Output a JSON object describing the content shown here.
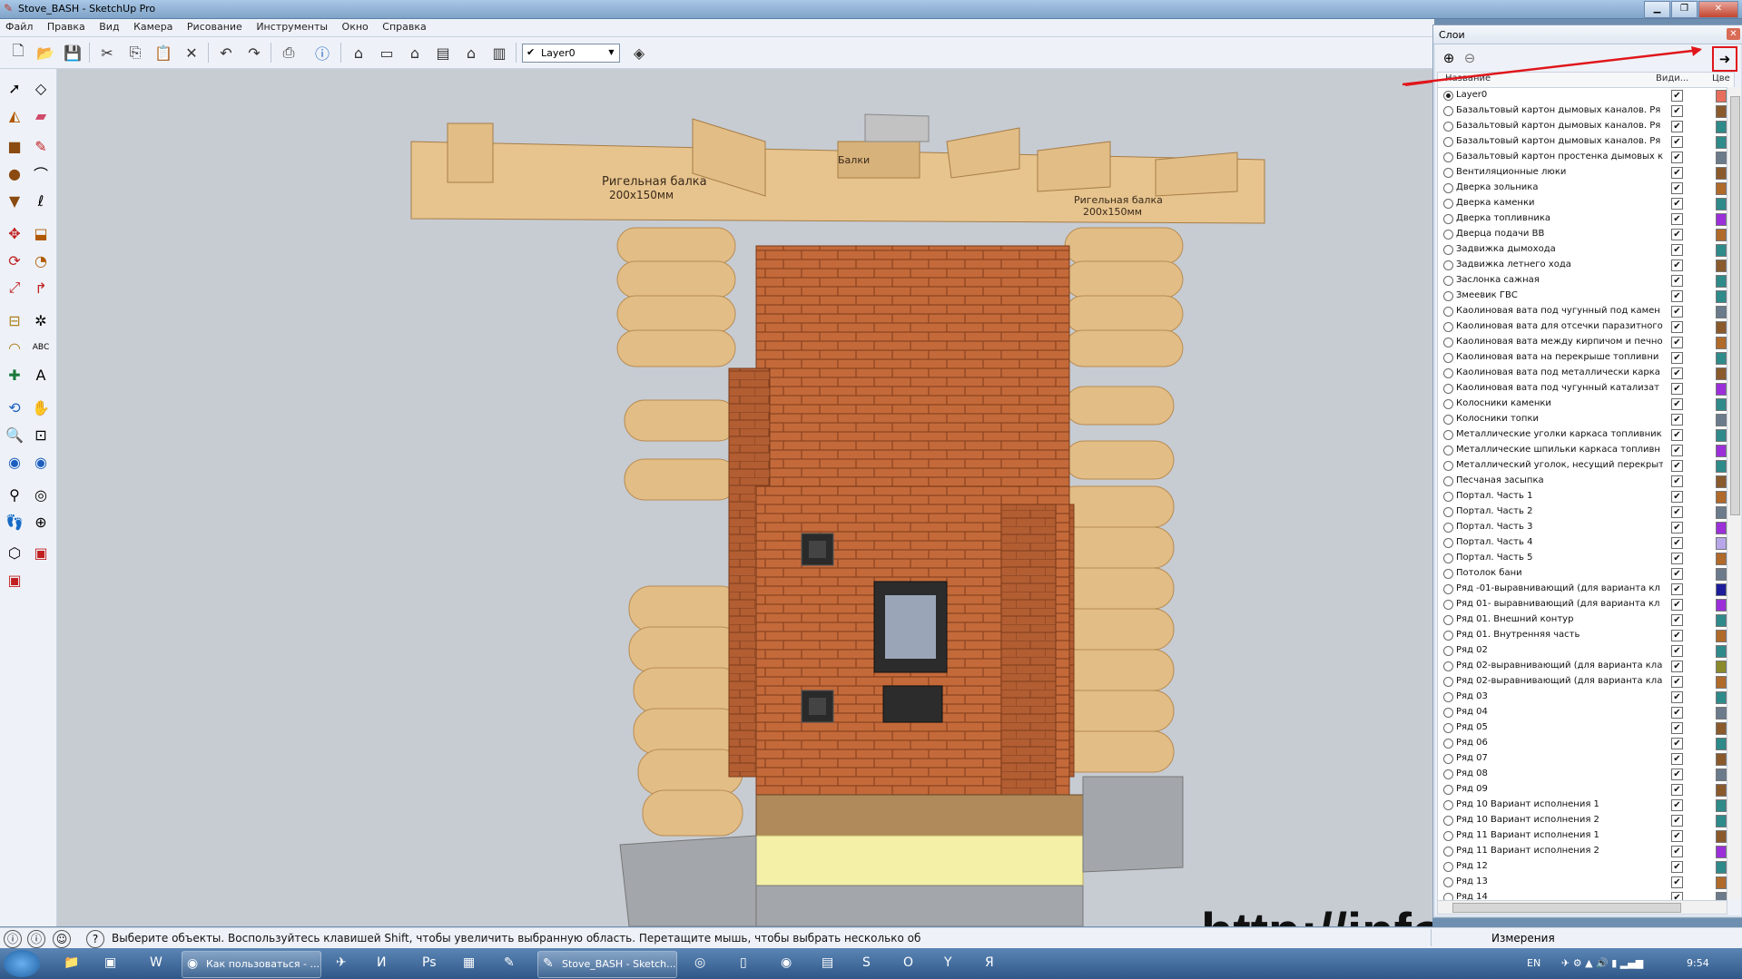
{
  "window": {
    "title": "Stove_BASH - SketchUp Pro",
    "min_icon": "minimize-icon",
    "max_icon": "maximize-icon",
    "close_icon": "close-icon"
  },
  "menu": [
    "Файл",
    "Правка",
    "Вид",
    "Камера",
    "Рисование",
    "Инструменты",
    "Окно",
    "Справка"
  ],
  "toolbar": {
    "layer_value": "Layer0"
  },
  "model": {
    "label_left": "Ригельная балка",
    "label_left_size": "200х150мм",
    "label_middle": "Балки",
    "label_right": "Ригельная балка",
    "label_right_size": "200х150мм"
  },
  "watermark": "http://inforusbani.ru",
  "layers_panel": {
    "title": "Слои",
    "col_name": "Название",
    "col_visible": "Види...",
    "col_color": "Цве",
    "rows": [
      {
        "name": "Layer0",
        "active": true,
        "color": "#e86d5c"
      },
      {
        "name": "Базальтовый картон дымовых каналов. Ря",
        "active": false,
        "color": "#8a5a2c"
      },
      {
        "name": "Базальтовый картон дымовых каналов. Ря",
        "active": false,
        "color": "#2f8a8a"
      },
      {
        "name": "Базальтовый картон дымовых каналов. Ря",
        "active": false,
        "color": "#2f8a8a"
      },
      {
        "name": "Базальтовый картон простенка дымовых к",
        "active": false,
        "color": "#6b7b8c"
      },
      {
        "name": "Вентиляционные люки",
        "active": false,
        "color": "#8a5a2c"
      },
      {
        "name": "Дверка зольника",
        "active": false,
        "color": "#b06a2a"
      },
      {
        "name": "Дверка каменки",
        "active": false,
        "color": "#2f8a8a"
      },
      {
        "name": "Дверка топливника",
        "active": false,
        "color": "#9b30d9"
      },
      {
        "name": "Дверца подачи ВВ",
        "active": false,
        "color": "#b06a2a"
      },
      {
        "name": "Задвижка дымохода",
        "active": false,
        "color": "#2f8a8a"
      },
      {
        "name": "Задвижка летнего хода",
        "active": false,
        "color": "#8a5a2c"
      },
      {
        "name": "Заслонка сажная",
        "active": false,
        "color": "#2f8a8a"
      },
      {
        "name": "Змеевик ГВС",
        "active": false,
        "color": "#2f8a8a"
      },
      {
        "name": "Каолиновая вата  под чугунный под камен",
        "active": false,
        "color": "#6b7b8c"
      },
      {
        "name": "Каолиновая вата для отсечки паразитного",
        "active": false,
        "color": "#8a5a2c"
      },
      {
        "name": "Каолиновая вата между кирпичом и печно",
        "active": false,
        "color": "#b06a2a"
      },
      {
        "name": "Каолиновая вата на перекрыше топливни",
        "active": false,
        "color": "#2f8a8a"
      },
      {
        "name": "Каолиновая вата под металлически карка",
        "active": false,
        "color": "#8a5a2c"
      },
      {
        "name": "Каолиновая вата под чугунный катализат",
        "active": false,
        "color": "#9b30d9"
      },
      {
        "name": "Колосники каменки",
        "active": false,
        "color": "#2f8a8a"
      },
      {
        "name": "Колосники топки",
        "active": false,
        "color": "#6b7b8c"
      },
      {
        "name": "Металлические уголки каркаса топливник",
        "active": false,
        "color": "#2f8a8a"
      },
      {
        "name": "Металлические шпильки каркаса топливн",
        "active": false,
        "color": "#9b30d9"
      },
      {
        "name": "Металлический уголок, несущий перекрыт",
        "active": false,
        "color": "#2f8a8a"
      },
      {
        "name": "Песчаная засыпка",
        "active": false,
        "color": "#8a5a2c"
      },
      {
        "name": "Портал. Часть 1",
        "active": false,
        "color": "#b06a2a"
      },
      {
        "name": "Портал. Часть 2",
        "active": false,
        "color": "#6b7b8c"
      },
      {
        "name": "Портал. Часть 3",
        "active": false,
        "color": "#9b30d9"
      },
      {
        "name": "Портал. Часть 4",
        "active": false,
        "color": "#b7a7e8"
      },
      {
        "name": "Портал. Часть 5",
        "active": false,
        "color": "#b06a2a"
      },
      {
        "name": "Потолок бани",
        "active": false,
        "color": "#6b7b8c"
      },
      {
        "name": "Ряд -01-выравнивающий (для варианта кл",
        "active": false,
        "color": "#1d1d9b"
      },
      {
        "name": "Ряд 01- выравнивающий (для варианта кл",
        "active": false,
        "color": "#9b30d9"
      },
      {
        "name": "Ряд 01. Внешний контур",
        "active": false,
        "color": "#2f8a8a"
      },
      {
        "name": "Ряд 01. Внутренняя часть",
        "active": false,
        "color": "#b06a2a"
      },
      {
        "name": "Ряд 02",
        "active": false,
        "color": "#2f8a8a"
      },
      {
        "name": "Ряд 02-выравнивающий (для варианта кла",
        "active": false,
        "color": "#8a8a2c"
      },
      {
        "name": "Ряд 02-выравнивающий (для варианта кла",
        "active": false,
        "color": "#b06a2a"
      },
      {
        "name": "Ряд 03",
        "active": false,
        "color": "#2f8a8a"
      },
      {
        "name": "Ряд 04",
        "active": false,
        "color": "#6b7b8c"
      },
      {
        "name": "Ряд 05",
        "active": false,
        "color": "#8a5a2c"
      },
      {
        "name": "Ряд 06",
        "active": false,
        "color": "#2f8a8a"
      },
      {
        "name": "Ряд 07",
        "active": false,
        "color": "#8a5a2c"
      },
      {
        "name": "Ряд 08",
        "active": false,
        "color": "#6b7b8c"
      },
      {
        "name": "Ряд 09",
        "active": false,
        "color": "#8a5a2c"
      },
      {
        "name": "Ряд 10 Вариант исполнения 1",
        "active": false,
        "color": "#2f8a8a"
      },
      {
        "name": "Ряд 10 Вариант исполнения 2",
        "active": false,
        "color": "#2f8a8a"
      },
      {
        "name": "Ряд 11 Вариант исполнения 1",
        "active": false,
        "color": "#8a5a2c"
      },
      {
        "name": "Ряд 11 Вариант исполнения 2",
        "active": false,
        "color": "#9b30d9"
      },
      {
        "name": "Ряд 12",
        "active": false,
        "color": "#2f8a8a"
      },
      {
        "name": "Ряд 13",
        "active": false,
        "color": "#b06a2a"
      },
      {
        "name": "Ряд 14",
        "active": false,
        "color": "#6b7b8c"
      }
    ]
  },
  "status": {
    "message": "Выберите объекты. Воспользуйтесь клавишей Shift, чтобы увеличить выбранную область. Перетащите мышь, чтобы выбрать несколько об",
    "measurements_label": "Измерения"
  },
  "taskbar": {
    "items": [
      {
        "label": "Как пользоваться - ...",
        "icon": "chrome-icon"
      },
      {
        "label": "Stove_BASH - Sketch...",
        "icon": "sketchup-icon"
      }
    ],
    "lang": "EN",
    "time": "9:54"
  },
  "colors": {
    "accent_red": "#e0161b",
    "wood": "#e3c18c",
    "brick": "#c46a3a"
  }
}
